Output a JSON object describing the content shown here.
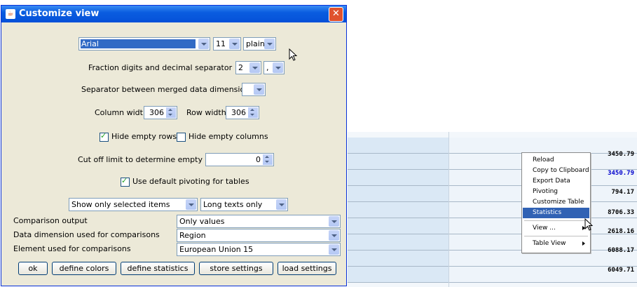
{
  "dialog": {
    "title": "Customize view",
    "close_symbol": "✕",
    "font": {
      "family": "Arial",
      "size": "11",
      "style": "plain"
    },
    "fraction": {
      "label": "Fraction digits and decimal separator",
      "digits": "2",
      "separator": ","
    },
    "merged_separator": {
      "label": "Separator between merged data dimensions",
      "value": ""
    },
    "column_width": {
      "label": "Column width",
      "value": "306"
    },
    "row_width": {
      "label": "Row width",
      "value": "306"
    },
    "hide_empty_rows": {
      "label": "Hide empty rows",
      "checked": true
    },
    "hide_empty_columns": {
      "label": "Hide empty columns",
      "checked": false
    },
    "cutoff": {
      "label": "Cut off limit to determine empty cells",
      "value": "0"
    },
    "default_pivoting": {
      "label": "Use default pivoting for tables",
      "checked": true
    },
    "show_items": "Show only selected items",
    "long_texts": "Long texts only",
    "comparison_output": {
      "label": "Comparison output",
      "value": "Only values"
    },
    "data_dimension": {
      "label": "Data dimension used for comparisons",
      "value": "Region"
    },
    "element_compare": {
      "label": "Element used for comparisons",
      "value": "European Union 15"
    },
    "buttons": {
      "ok": "ok",
      "define_colors": "define colors",
      "define_statistics": "define statistics",
      "store_settings": "store settings",
      "load_settings": "load settings"
    }
  },
  "context_menu": {
    "items": [
      "Reload",
      "Copy to Clipboard",
      "Export Data",
      "Pivoting",
      "Customize Table",
      "Statistics"
    ],
    "view": "View ...",
    "table_view": "Table View",
    "selected": "Statistics"
  },
  "table": {
    "values": [
      "3450.79",
      "3450.79",
      "794.17",
      "8706.33",
      "2618.16",
      "6088.17",
      "6049.71"
    ],
    "highlight_color": "#0000cc"
  },
  "colors": {
    "title_bar": "#0a5de0",
    "selection": "#3162b4",
    "dialog_bg": "#ece9d8"
  }
}
